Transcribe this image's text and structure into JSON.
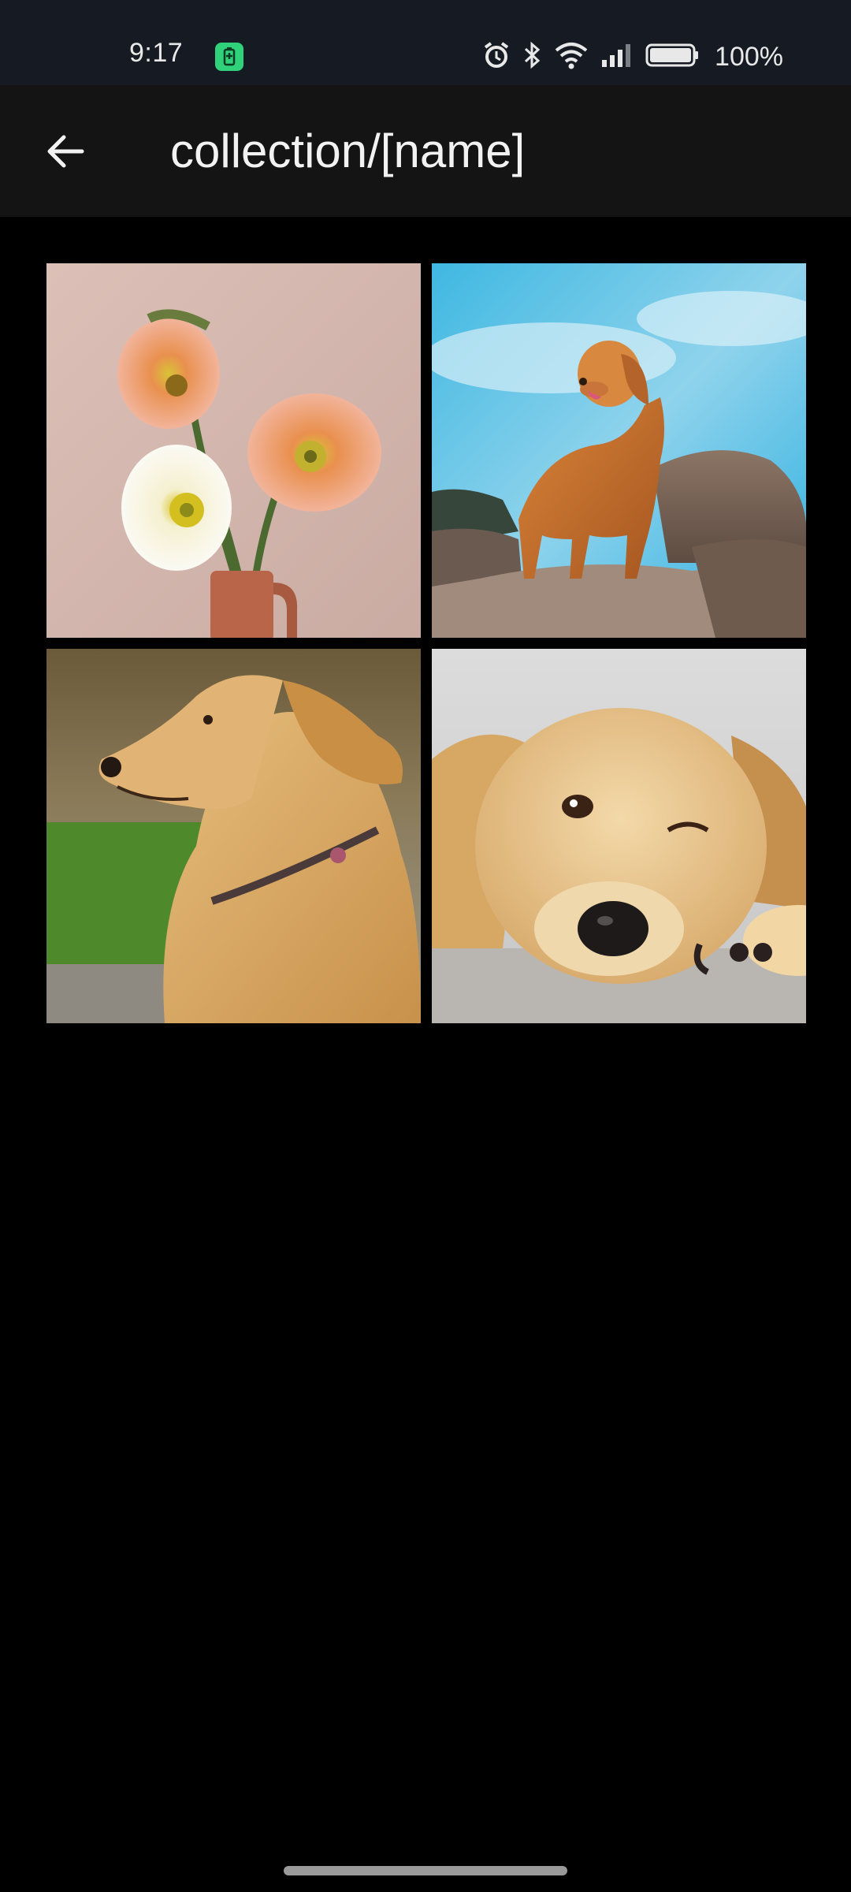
{
  "status_bar": {
    "time": "9:17",
    "battery_percent": "100%",
    "icons": [
      "battery-saver-icon",
      "alarm-icon",
      "bluetooth-icon",
      "wifi-icon",
      "signal-icon",
      "battery-icon"
    ]
  },
  "app_bar": {
    "title": "collection/[name]",
    "back_icon": "arrow-left-icon"
  },
  "gallery": {
    "columns": 2,
    "items": [
      {
        "subject": "flowers-in-vase"
      },
      {
        "subject": "dog-on-rocks"
      },
      {
        "subject": "golden-retriever-profile"
      },
      {
        "subject": "puppy-lying-down"
      }
    ]
  },
  "colors": {
    "background": "#000000",
    "status_bar": "#161a22",
    "app_bar": "#141414",
    "accent_green": "#2fd27a"
  }
}
